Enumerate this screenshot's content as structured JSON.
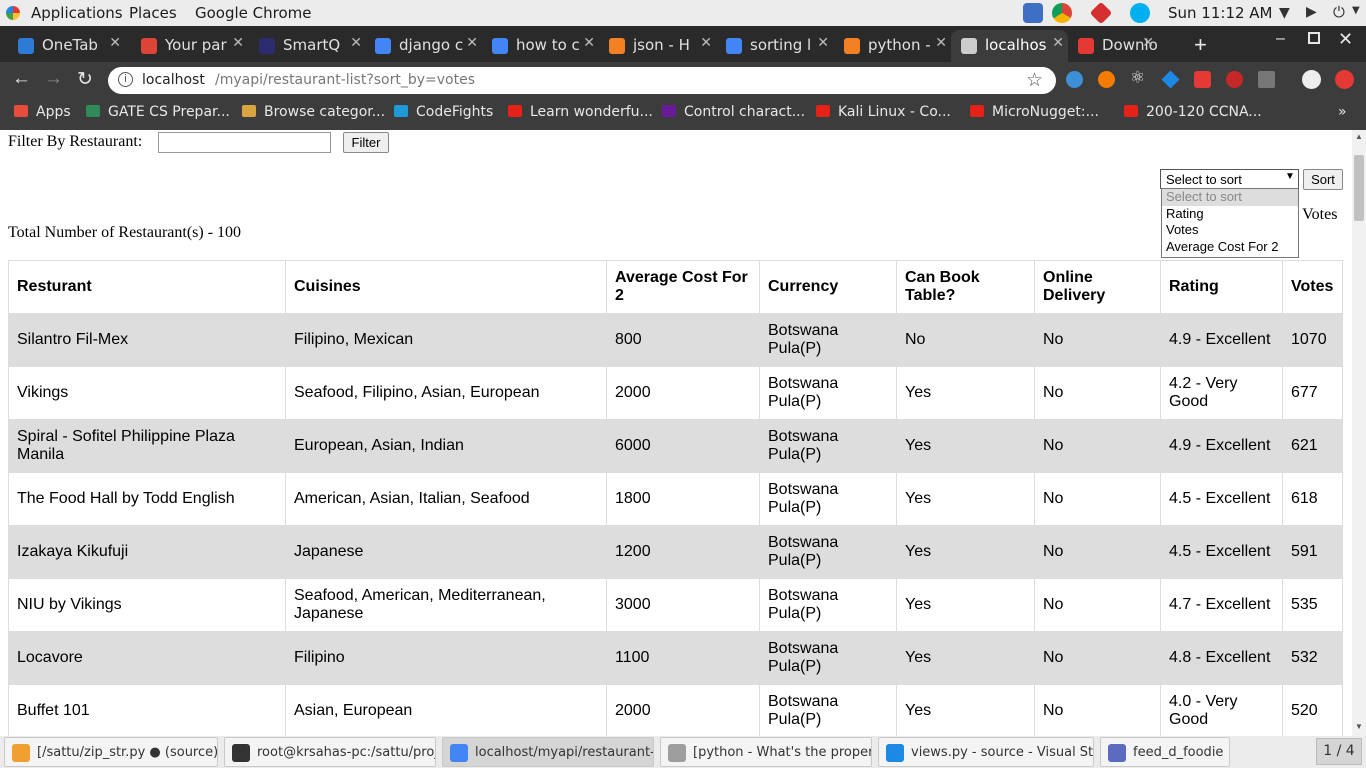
{
  "topbar": {
    "applications": "Applications",
    "places": "Places",
    "app": "Google Chrome",
    "clock": "Sun 11:12 AM"
  },
  "tabs": [
    {
      "title": "OneTab",
      "icon": "onetab-icon",
      "color": "#2e7bd6"
    },
    {
      "title": "Your par",
      "icon": "gmail-icon",
      "color": "#db4437"
    },
    {
      "title": "SmartQ",
      "icon": "smartq-icon",
      "color": "#2b2b6e"
    },
    {
      "title": "django c",
      "icon": "google-icon",
      "color": "#4285f4"
    },
    {
      "title": "how to c",
      "icon": "google-icon",
      "color": "#4285f4"
    },
    {
      "title": "json - H",
      "icon": "stackoverflow-icon",
      "color": "#f48024"
    },
    {
      "title": "sorting l",
      "icon": "google-icon",
      "color": "#4285f4"
    },
    {
      "title": "python -",
      "icon": "stackoverflow-icon",
      "color": "#f48024"
    },
    {
      "title": "localhos",
      "icon": "globe-icon",
      "color": "#cccccc"
    },
    {
      "title": "Downlo",
      "icon": "download-site-icon",
      "color": "#e53935"
    }
  ],
  "address": {
    "host": "localhost",
    "path": "/myapi/restaurant-list?sort_by=votes"
  },
  "bookmarks": [
    {
      "label": "Apps",
      "color": "#e74c3c"
    },
    {
      "label": "GATE CS Prepar...",
      "color": "#2e8b57"
    },
    {
      "label": "Browse categor...",
      "color": "#d9a441"
    },
    {
      "label": "CodeFights",
      "color": "#1e9bd7"
    },
    {
      "label": "Learn wonderfu...",
      "color": "#e62117"
    },
    {
      "label": "Control charact...",
      "color": "#6a1b9a"
    },
    {
      "label": "Kali Linux - Co...",
      "color": "#e62117"
    },
    {
      "label": "MicroNugget:...",
      "color": "#e62117"
    },
    {
      "label": "200-120 CCNA...",
      "color": "#e62117"
    }
  ],
  "filter": {
    "label": "Filter By Restaurant:",
    "value": "",
    "button": "Filter"
  },
  "sort": {
    "selected": "Select to sort",
    "button": "Sort",
    "options": [
      "Select to sort",
      "Rating",
      "Votes",
      "Average Cost For 2"
    ],
    "sorted_by_suffix": ": Votes"
  },
  "total": "Total Number of Restaurant(s) - 100",
  "table": {
    "headers": [
      "Resturant",
      "Cuisines",
      "Average Cost For 2",
      "Currency",
      "Can Book Table?",
      "Online Delivery",
      "Rating",
      "Votes"
    ],
    "rows": [
      [
        "Silantro Fil-Mex",
        "Filipino, Mexican",
        "800",
        "Botswana Pula(P)",
        "No",
        "No",
        "4.9 - Excellent",
        "1070"
      ],
      [
        "Vikings",
        "Seafood, Filipino, Asian, European",
        "2000",
        "Botswana Pula(P)",
        "Yes",
        "No",
        "4.2 - Very Good",
        "677"
      ],
      [
        "Spiral - Sofitel Philippine Plaza Manila",
        "European, Asian, Indian",
        "6000",
        "Botswana Pula(P)",
        "Yes",
        "No",
        "4.9 - Excellent",
        "621"
      ],
      [
        "The Food Hall by Todd English",
        "American, Asian, Italian, Seafood",
        "1800",
        "Botswana Pula(P)",
        "Yes",
        "No",
        "4.5 - Excellent",
        "618"
      ],
      [
        "Izakaya Kikufuji",
        "Japanese",
        "1200",
        "Botswana Pula(P)",
        "Yes",
        "No",
        "4.5 - Excellent",
        "591"
      ],
      [
        "NIU by Vikings",
        "Seafood, American, Mediterranean, Japanese",
        "3000",
        "Botswana Pula(P)",
        "Yes",
        "No",
        "4.7 - Excellent",
        "535"
      ],
      [
        "Locavore",
        "Filipino",
        "1100",
        "Botswana Pula(P)",
        "Yes",
        "No",
        "4.8 - Excellent",
        "532"
      ],
      [
        "Buffet 101",
        "Asian, European",
        "2000",
        "Botswana Pula(P)",
        "Yes",
        "No",
        "4.0 - Very Good",
        "520"
      ]
    ]
  },
  "taskbar": {
    "items": [
      {
        "label": "[/sattu/zip_str.py ● (source)...",
        "color": "#f0a030"
      },
      {
        "label": "root@krsahas-pc:/sattu/proj...",
        "color": "#333333"
      },
      {
        "label": "localhost/myapi/restaurant-li...",
        "color": "#4285f4"
      },
      {
        "label": "[python - What's the proper...",
        "color": "#9e9e9e"
      },
      {
        "label": "views.py - source - Visual St...",
        "color": "#1e88e5"
      },
      {
        "label": "feed_d_foodie",
        "color": "#5c6bc0"
      }
    ],
    "workspace": "1 / 4"
  }
}
